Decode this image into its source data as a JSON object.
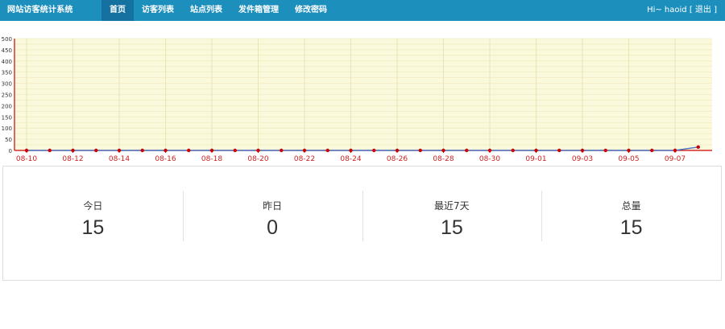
{
  "app": {
    "title": "网站访客统计系统"
  },
  "nav": {
    "items": [
      {
        "label": "首页",
        "active": true
      },
      {
        "label": "访客列表",
        "active": false
      },
      {
        "label": "站点列表",
        "active": false
      },
      {
        "label": "发件箱管理",
        "active": false
      },
      {
        "label": "修改密码",
        "active": false
      }
    ]
  },
  "user": {
    "greeting": "Hi~ haoid",
    "logout": "[ 退出 ]"
  },
  "colors": {
    "header_bg": "#1d8fbd",
    "nav_active_bg": "#1572a0",
    "chart_bg": "#fbf9dc",
    "axis_line": "#cc0000",
    "series_line": "#4a74c4",
    "point_color": "#cc0000",
    "tick_label": "#cc2222"
  },
  "chart_data": {
    "type": "line",
    "x": [
      "08-10",
      "08-11",
      "08-12",
      "08-13",
      "08-14",
      "08-15",
      "08-16",
      "08-17",
      "08-18",
      "08-19",
      "08-20",
      "08-21",
      "08-22",
      "08-23",
      "08-24",
      "08-25",
      "08-26",
      "08-27",
      "08-28",
      "08-29",
      "08-30",
      "08-31",
      "09-01",
      "09-02",
      "09-03",
      "09-04",
      "09-05",
      "09-06",
      "09-07",
      "09-08"
    ],
    "x_tick_labels": [
      "08-10",
      "08-12",
      "08-14",
      "08-16",
      "08-18",
      "08-20",
      "08-22",
      "08-24",
      "08-26",
      "08-28",
      "08-30",
      "09-01",
      "09-03",
      "09-05",
      "09-07"
    ],
    "series": [
      {
        "values": [
          0,
          0,
          0,
          0,
          0,
          0,
          0,
          0,
          0,
          0,
          0,
          0,
          0,
          0,
          0,
          0,
          0,
          0,
          0,
          0,
          0,
          0,
          0,
          0,
          0,
          0,
          0,
          0,
          0,
          15
        ]
      }
    ],
    "y_ticks": [
      0,
      50,
      100,
      150,
      200,
      250,
      300,
      350,
      400,
      450,
      500
    ],
    "ylim": [
      0,
      500
    ],
    "grid": true
  },
  "stats": [
    {
      "label": "今日",
      "value": "15"
    },
    {
      "label": "昨日",
      "value": "0"
    },
    {
      "label": "最近7天",
      "value": "15"
    },
    {
      "label": "总量",
      "value": "15"
    }
  ]
}
